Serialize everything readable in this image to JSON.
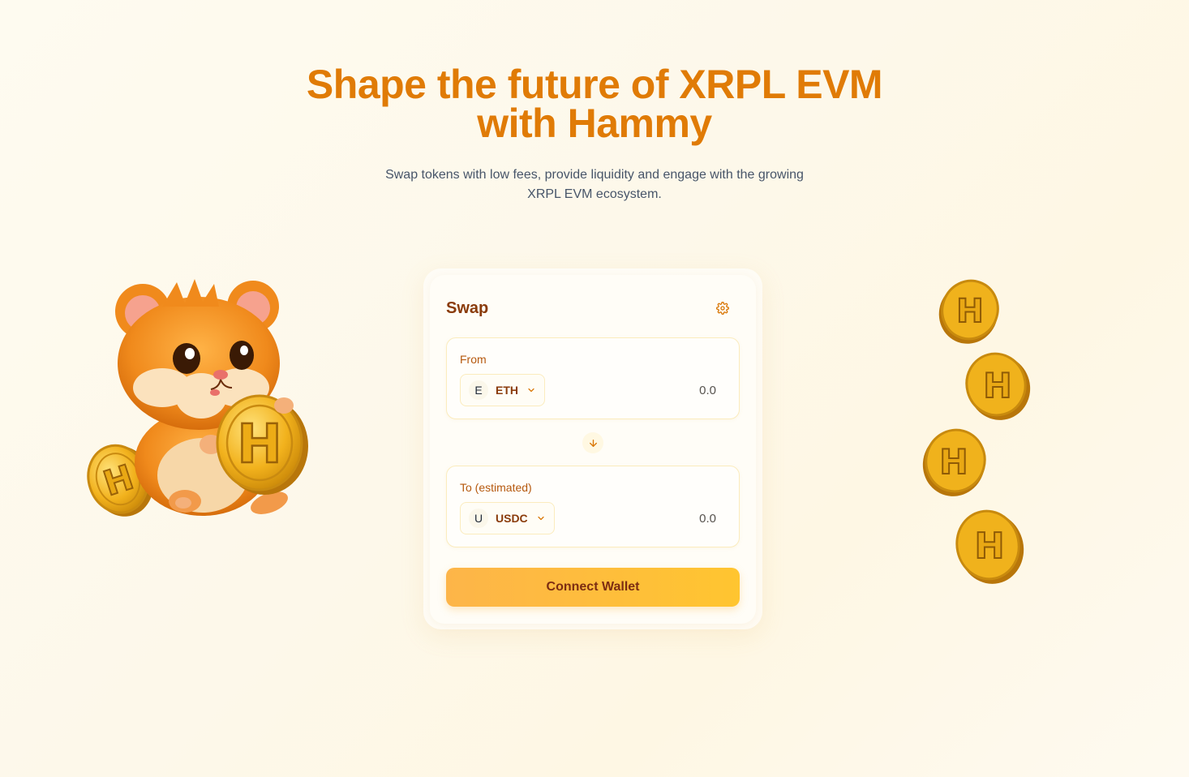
{
  "hero": {
    "title_line1": "Shape the future of XRPL EVM",
    "title_line2": "with Hammy",
    "subtitle_line1": "Swap tokens with low fees, provide liquidity and engage with the growing",
    "subtitle_line2": "XRPL EVM ecosystem."
  },
  "swap": {
    "title": "Swap",
    "settings_icon": "gear-icon",
    "from": {
      "label": "From",
      "token_initial": "E",
      "token_symbol": "ETH",
      "amount": "0.0"
    },
    "switch_icon": "arrow-down-icon",
    "to": {
      "label": "To (estimated)",
      "token_initial": "U",
      "token_symbol": "USDC",
      "amount": "0.0"
    },
    "connect_label": "Connect Wallet"
  },
  "colors": {
    "accent": "#e07b06",
    "brand_dark": "#8a3b0b",
    "button_start": "#fdb549",
    "button_end": "#ffc530",
    "background": "#fefaef"
  },
  "decorations": {
    "mascot": "hamster-holding-coin-illustration",
    "coin_letter": "H"
  }
}
